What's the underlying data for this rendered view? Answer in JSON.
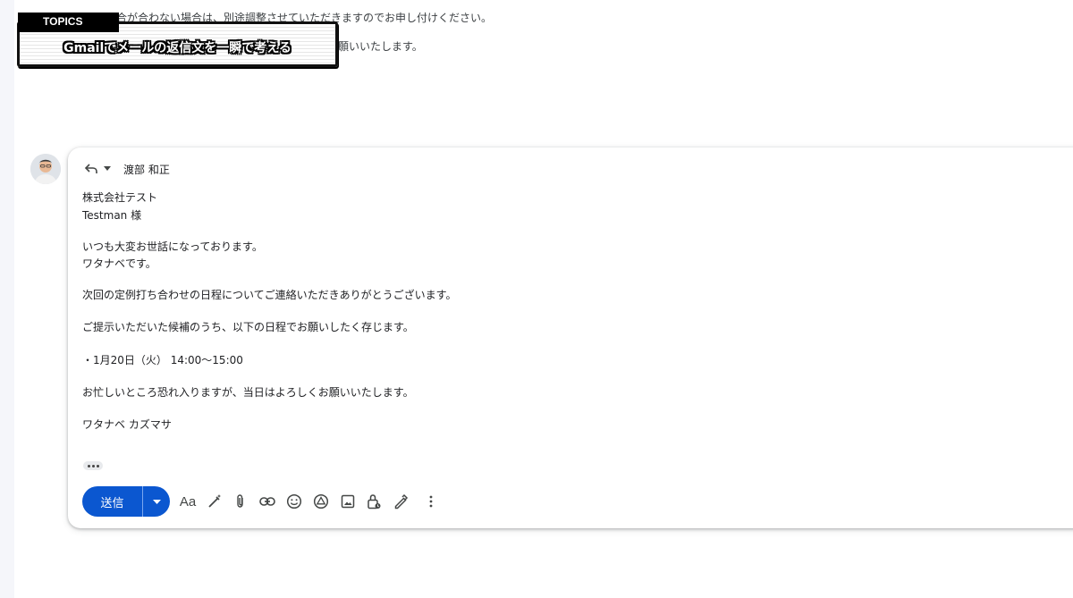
{
  "previous_message": {
    "line1": "合が合わない場合は、別途調整させていただきますのでお申し付けください。",
    "line2": "願いいたします。"
  },
  "topics": {
    "tag": "TOPICS",
    "title": "Gmailでメールの返信文を一瞬で考える"
  },
  "compose": {
    "recipient": "渡部 和正",
    "body": [
      "株式会社テスト",
      "Testman 様",
      "いつも大変お世話になっております。",
      "ワタナベです。",
      "次回の定例打ち合わせの日程についてご連絡いただきありがとうございます。",
      "ご提示いただいた候補のうち、以下の日程でお願いしたく存じます。",
      "・1月20日（火） 14:00〜15:00",
      "お忙しいところ恐れ入りますが、当日はよろしくお願いいたします。",
      "ワタナベ カズマサ"
    ],
    "send_label": "送信",
    "format_label": "Aa"
  },
  "icons": [
    "reply-icon",
    "dropdown-arrow-icon",
    "more-options-icon",
    "formatting-icon",
    "ai-write-icon",
    "attach-icon",
    "link-icon",
    "emoji-icon",
    "drive-icon",
    "photo-icon",
    "confidential-icon",
    "signature-icon",
    "more-vert-icon"
  ],
  "colors": {
    "send_button": "#0b57d0",
    "rail": "#f5f6fa"
  }
}
